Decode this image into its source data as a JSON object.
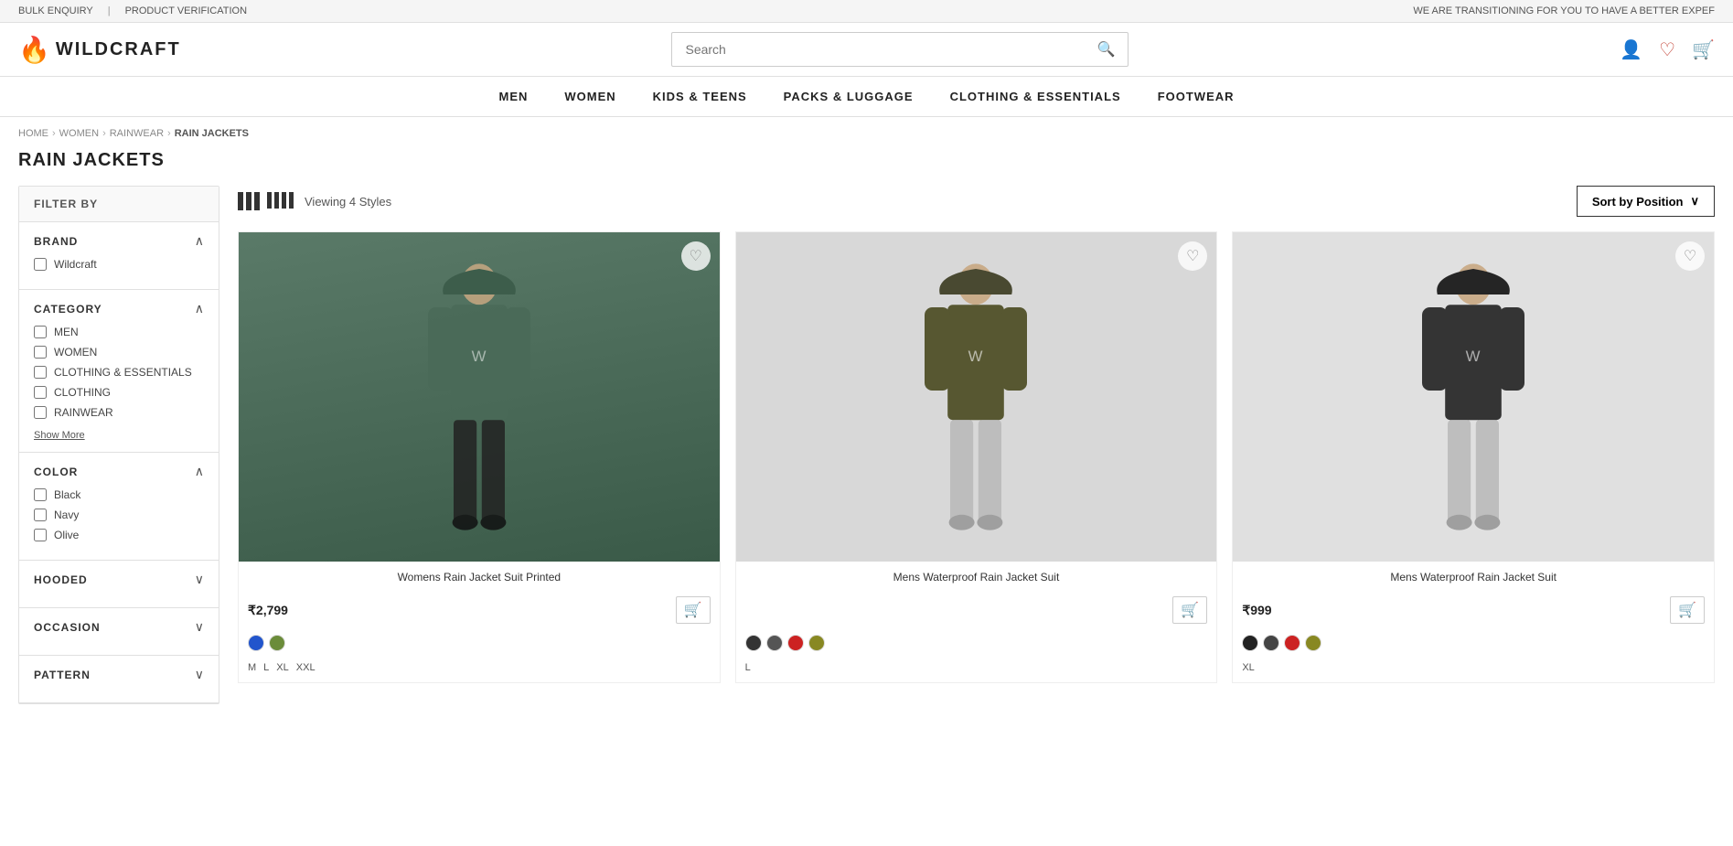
{
  "topbar": {
    "left": [
      "BULK ENQUIRY",
      "|",
      "PRODUCT VERIFICATION"
    ],
    "right": "WE ARE TRANSITIONING FOR YOU TO HAVE A BETTER EXPEF"
  },
  "header": {
    "logo_text": "WILDCRAFT",
    "search_placeholder": "Search",
    "icons": [
      "user",
      "heart",
      "cart"
    ]
  },
  "nav": {
    "items": [
      "MEN",
      "WOMEN",
      "KIDS & TEENS",
      "PACKS & LUGGAGE",
      "CLOTHING & ESSENTIALS",
      "FOOTWEAR"
    ]
  },
  "breadcrumb": {
    "items": [
      "HOME",
      "WOMEN",
      "RAINWEAR",
      "RAIN JACKETS"
    ]
  },
  "page_title": "RAIN JACKETS",
  "sidebar": {
    "filter_header": "FILTER BY",
    "sections": [
      {
        "id": "brand",
        "title": "BRAND",
        "open": true,
        "options": [
          {
            "label": "Wildcraft",
            "checked": false
          }
        ]
      },
      {
        "id": "category",
        "title": "CATEGORY",
        "open": true,
        "options": [
          {
            "label": "MEN",
            "checked": false
          },
          {
            "label": "WOMEN",
            "checked": false
          },
          {
            "label": "CLOTHING & ESSENTIALS",
            "checked": false
          },
          {
            "label": "CLOTHING",
            "checked": false
          },
          {
            "label": "RAINWEAR",
            "checked": false
          }
        ],
        "show_more": "Show More"
      },
      {
        "id": "color",
        "title": "COLOR",
        "open": true,
        "options": [
          {
            "label": "Black",
            "checked": false
          },
          {
            "label": "Navy",
            "checked": false
          },
          {
            "label": "Olive",
            "checked": false
          }
        ]
      },
      {
        "id": "hooded",
        "title": "HOODED",
        "open": false,
        "options": []
      },
      {
        "id": "occasion",
        "title": "OCCASION",
        "open": false,
        "options": []
      },
      {
        "id": "pattern",
        "title": "PATTERN",
        "open": false,
        "options": []
      }
    ]
  },
  "toolbar": {
    "viewing_text": "Viewing 4 Styles",
    "sort_label": "Sort by Position"
  },
  "products": [
    {
      "id": 1,
      "name": "Womens Rain Jacket Suit Printed",
      "price": "₹2,799",
      "bg_color": "#6b8c7a",
      "colors": [
        "#2255cc",
        "#6b8c3a"
      ],
      "sizes": [
        "M",
        "L",
        "XL",
        "XXL"
      ],
      "wishlist": false
    },
    {
      "id": 2,
      "name": "Mens Waterproof Rain Jacket Suit",
      "price": null,
      "bg_color": "#555",
      "colors": [
        "#333",
        "#555",
        "#cc2222",
        "#888822"
      ],
      "sizes": [
        "L"
      ],
      "wishlist": false
    },
    {
      "id": 3,
      "name": "Mens Waterproof Rain Jacket Suit",
      "price": "₹999",
      "bg_color": "#aaa",
      "colors": [
        "#222",
        "#444",
        "#cc2222",
        "#888822"
      ],
      "sizes": [
        "XL"
      ],
      "wishlist": false
    }
  ]
}
